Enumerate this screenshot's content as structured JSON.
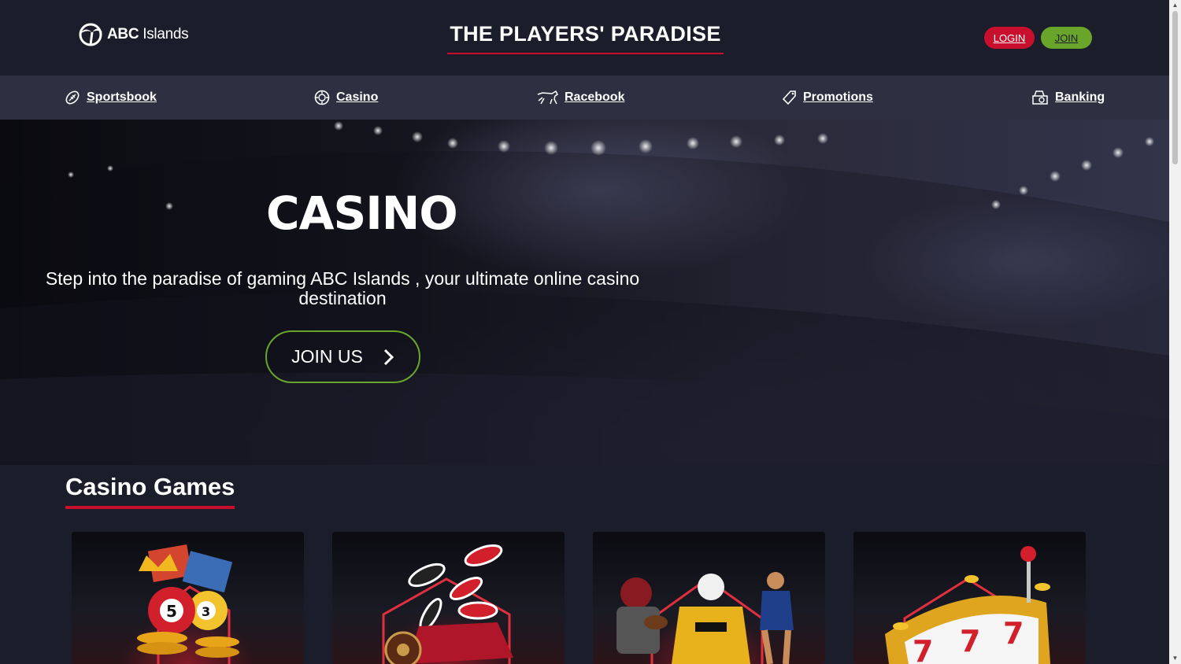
{
  "header": {
    "logo_text_bold": "ABC",
    "logo_text_rest": " Islands",
    "tagline": "THE PLAYERS' PARADISE",
    "login_label": "LOGIN",
    "join_label": "JOIN"
  },
  "nav": {
    "items": [
      {
        "label": "Sportsbook",
        "icon": "football-icon"
      },
      {
        "label": "Casino",
        "icon": "casino-chip-icon"
      },
      {
        "label": "Racebook",
        "icon": "horse-icon"
      },
      {
        "label": "Promotions",
        "icon": "tag-icon"
      },
      {
        "label": "Banking",
        "icon": "cash-register-icon"
      }
    ]
  },
  "hero": {
    "title": "CASINO",
    "subtitle": "Step into the paradise of gaming ABC Islands , your ultimate online casino destination",
    "cta_label": "JOIN US"
  },
  "games": {
    "section_title": "Casino Games",
    "cards": [
      {
        "name": "lottery-keno-card"
      },
      {
        "name": "table-games-card"
      },
      {
        "name": "sports-card"
      },
      {
        "name": "slots-card"
      }
    ]
  },
  "colors": {
    "background": "#1c1d2b",
    "nav": "#2e3042",
    "accent_red": "#c8102e",
    "accent_green": "#6aa52b"
  }
}
